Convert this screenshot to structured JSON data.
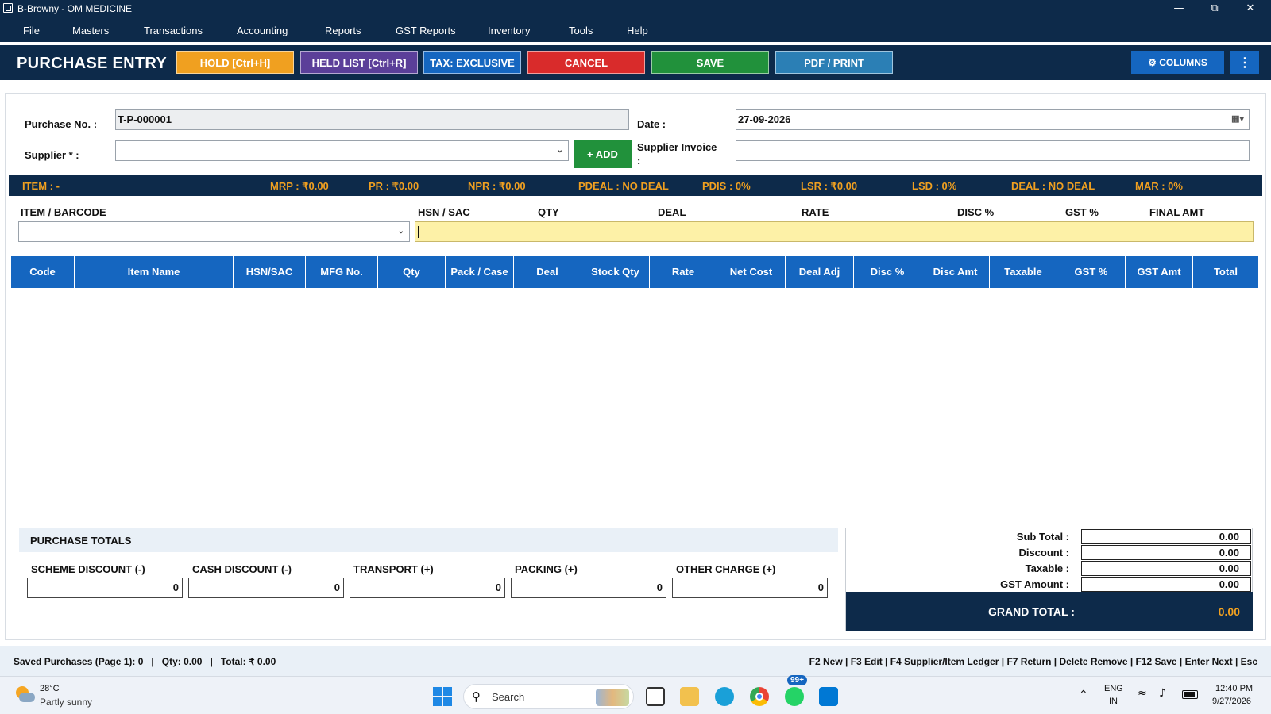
{
  "window": {
    "title": "B-Browny - OM MEDICINE"
  },
  "menu": [
    "File",
    "Masters",
    "Transactions",
    "Accounting",
    "Reports",
    "GST Reports",
    "Inventory",
    "Tools",
    "Help"
  ],
  "toolbar": {
    "page_title": "PURCHASE ENTRY",
    "hold": "HOLD [Ctrl+H]",
    "held_list": "HELD LIST [Ctrl+R]",
    "tax": "TAX: EXCLUSIVE",
    "cancel": "CANCEL",
    "save": "SAVE",
    "pdf": "PDF / PRINT",
    "columns": "COLUMNS",
    "more": "⋮"
  },
  "colors": {
    "navy": "#0d2a4a",
    "orange": "#f0a020",
    "purple": "#5b3f99",
    "blue": "#1566c0",
    "red": "#d92b2b",
    "green": "#21913b",
    "teal": "#2b7fb5"
  },
  "form": {
    "purchase_no_label": "Purchase No. :",
    "purchase_no": "T-P-000001",
    "date_label": "Date :",
    "date": "27-09-2026",
    "supplier_label": "Supplier * :",
    "supplier": "",
    "add_label": "+ ADD",
    "supplier_invoice_label": "Supplier Invoice",
    "supplier_invoice_colon": ":",
    "supplier_invoice": ""
  },
  "info": {
    "item": "ITEM : -",
    "mrp": "MRP : ₹0.00",
    "pr": "PR : ₹0.00",
    "npr": "NPR : ₹0.00",
    "pdeal": "PDEAL : NO DEAL",
    "pdis": "PDIS : 0%",
    "lsr": "LSR : ₹0.00",
    "lsd": "LSD : 0%",
    "deal": "DEAL : NO DEAL",
    "mar": "MAR : 0%"
  },
  "entry": {
    "item_barcode": "ITEM / BARCODE",
    "hsn": "HSN / SAC",
    "qty": "QTY",
    "deal": "DEAL",
    "rate": "RATE",
    "disc": "DISC %",
    "gst": "GST %",
    "final": "FINAL AMT"
  },
  "table": {
    "columns": [
      "Code",
      "Item Name",
      "HSN/SAC",
      "MFG No.",
      "Qty",
      "Pack / Case",
      "Deal",
      "Stock Qty",
      "Rate",
      "Net Cost",
      "Deal Adj",
      "Disc %",
      "Disc Amt",
      "Taxable",
      "GST %",
      "GST Amt",
      "Total"
    ],
    "rows": []
  },
  "totals": {
    "title": "PURCHASE TOTALS",
    "scheme_label": "SCHEME DISCOUNT (-)",
    "scheme": "0",
    "cash_label": "CASH DISCOUNT (-)",
    "cash": "0",
    "transport_label": "TRANSPORT (+)",
    "transport": "0",
    "packing_label": "PACKING (+)",
    "packing": "0",
    "other_label": "OTHER CHARGE (+)",
    "other": "0"
  },
  "summary": {
    "subtotal_label": "Sub Total :",
    "subtotal": "0.00",
    "discount_label": "Discount :",
    "discount": "0.00",
    "taxable_label": "Taxable :",
    "taxable": "0.00",
    "gst_label": "GST Amount :",
    "gst": "0.00",
    "grand_label": "GRAND TOTAL :",
    "grand": "0.00"
  },
  "status": {
    "left": "Saved Purchases (Page 1): 0   |   Qty: 0.00   |   Total: ₹ 0.00",
    "right": "F2 New | F3 Edit | F4 Supplier/Item Ledger | F7 Return | Delete Remove | F12 Save | Enter Next | Esc"
  },
  "taskbar": {
    "temp": "28°C",
    "weather": "Partly sunny",
    "search": "Search",
    "badge": "99+",
    "lang1": "ENG",
    "lang2": "IN",
    "time": "12:40 PM",
    "date": "9/27/2026"
  }
}
